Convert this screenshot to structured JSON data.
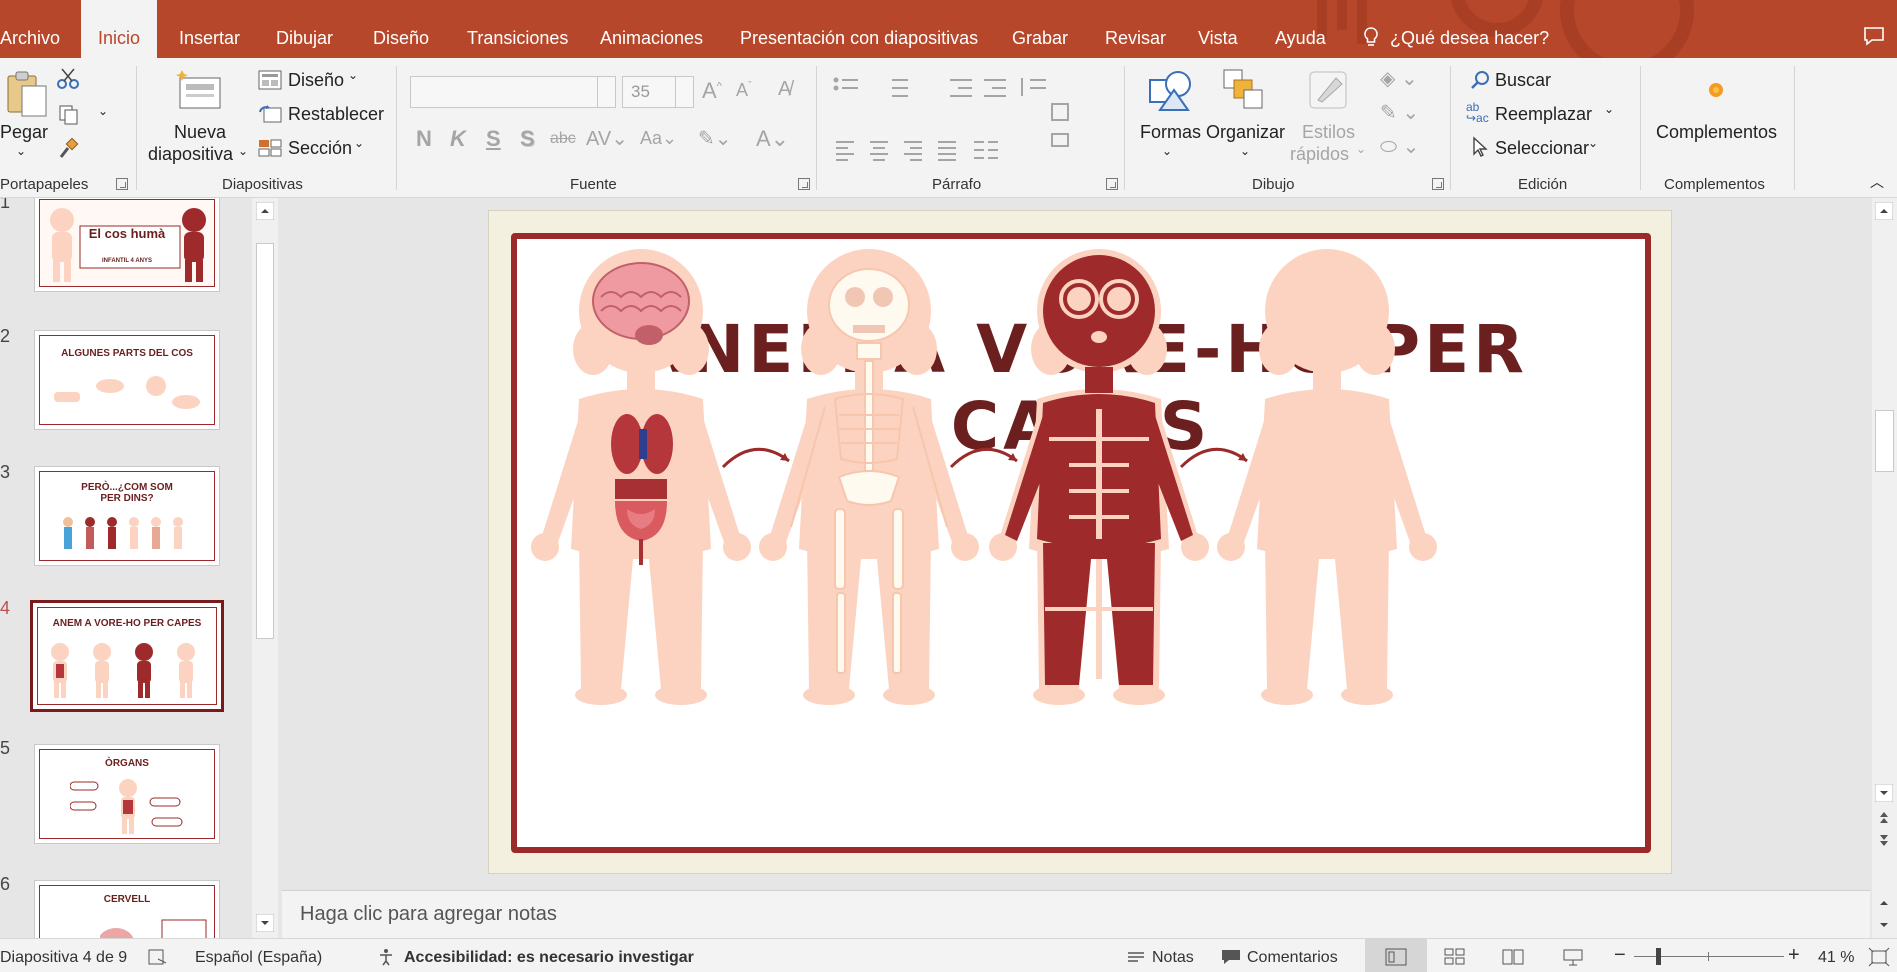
{
  "tabs": [
    {
      "label": "Archivo",
      "active": false
    },
    {
      "label": "Inicio",
      "active": true
    },
    {
      "label": "Insertar",
      "active": false
    },
    {
      "label": "Dibujar",
      "active": false
    },
    {
      "label": "Diseño",
      "active": false
    },
    {
      "label": "Transiciones",
      "active": false
    },
    {
      "label": "Animaciones",
      "active": false
    },
    {
      "label": "Presentación con diapositivas",
      "active": false
    },
    {
      "label": "Grabar",
      "active": false
    },
    {
      "label": "Revisar",
      "active": false
    },
    {
      "label": "Vista",
      "active": false
    },
    {
      "label": "Ayuda",
      "active": false
    }
  ],
  "tell_me": "¿Qué desea hacer?",
  "ribbon": {
    "clipboard": {
      "paste": "Pegar",
      "label": "Portapapeles"
    },
    "slides": {
      "new_slide_1": "Nueva",
      "new_slide_2": "diapositiva",
      "layout": "Diseño",
      "reset": "Restablecer",
      "section": "Sección",
      "label": "Diapositivas"
    },
    "font": {
      "size": "35",
      "label": "Fuente",
      "bold": "N",
      "italic": "K",
      "underline": "S",
      "shadow": "S",
      "strike": "abc"
    },
    "paragraph": {
      "label": "Párrafo"
    },
    "drawing": {
      "shapes": "Formas",
      "arrange": "Organizar",
      "quick_styles_1": "Estilos",
      "quick_styles_2": "rápidos",
      "label": "Dibujo"
    },
    "editing": {
      "find": "Buscar",
      "replace": "Reemplazar",
      "select": "Seleccionar",
      "label": "Edición"
    },
    "addins": {
      "button": "Complementos",
      "label": "Complementos"
    }
  },
  "thumbnails": [
    {
      "num": "1",
      "title": "El cos humà",
      "subtitle": "INFANTIL 4 ANYS",
      "active": false
    },
    {
      "num": "2",
      "title": "ALGUNES PARTS DEL COS",
      "active": false
    },
    {
      "num": "3",
      "title": "PERÒ...¿COM SOM PER DINS?",
      "active": false
    },
    {
      "num": "4",
      "title": "ANEM A VORE-HO PER CAPES",
      "active": true
    },
    {
      "num": "5",
      "title": "ÒRGANS",
      "active": false
    },
    {
      "num": "6",
      "title": "CERVELL",
      "active": false
    }
  ],
  "slide": {
    "title": "ANEM A VORE-HO PER CAPES"
  },
  "notes_placeholder": "Haga clic para agregar notas",
  "status": {
    "slide_of": "Diapositiva 4 de 9",
    "language": "Español (España)",
    "accessibility": "Accesibilidad: es necesario investigar",
    "notes": "Notas",
    "comments": "Comentarios",
    "zoom": "41 %"
  },
  "colors": {
    "accent": "#b7472a",
    "slide_border": "#9b2a2a",
    "title": "#6b1f1f",
    "skin": "#fcd3c1",
    "muscle": "#9e2a2b"
  }
}
